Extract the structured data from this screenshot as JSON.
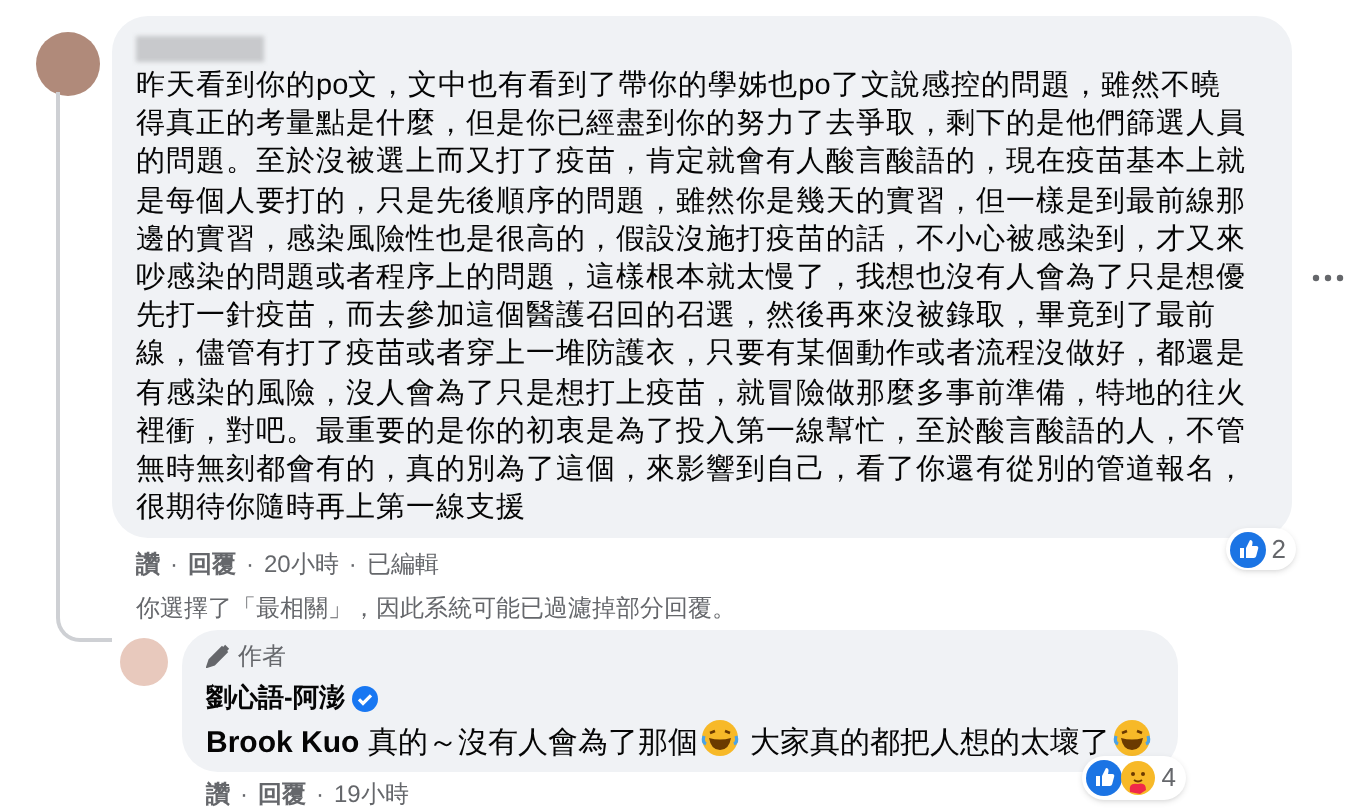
{
  "comment": {
    "text": "昨天看到你的po文，文中也有看到了帶你的學姊也po了文說感控的問題，雖然不曉得真正的考量點是什麼，但是你已經盡到你的努力了去爭取，剩下的是他們篩選人員的問題。至於沒被選上而又打了疫苗，肯定就會有人酸言酸語的，現在疫苗基本上就是每個人要打的，只是先後順序的問題，雖然你是幾天的實習，但一樣是到最前線那邊的實習，感染風險性也是很高的，假設沒施打疫苗的話，不小心被感染到，才又來吵感染的問題或者程序上的問題，這樣根本就太慢了，我想也沒有人會為了只是想優先打一針疫苗，而去參加這個醫護召回的召選，然後再來沒被錄取，畢竟到了最前線，儘管有打了疫苗或者穿上一堆防護衣，只要有某個動作或者流程沒做好，都還是有感染的風險，沒人會為了只是想打上疫苗，就冒險做那麼多事前準備，特地的往火裡衝，對吧。最重要的是你的初衷是為了投入第一線幫忙，至於酸言酸語的人，不管無時無刻都會有的，真的別為了這個，來影響到自己，看了你還有從別的管道報名，很期待你隨時再上第一線支援",
    "actions": [
      "讚",
      "回覆",
      "20小時",
      "已編輯"
    ],
    "reaction_count": "2"
  },
  "separator": "·",
  "filter_notice": "你選擇了「最相關」，因此系統可能已過濾掉部分回覆。",
  "reply": {
    "badge": "作者",
    "author": "劉心語-阿澎",
    "verified": true,
    "parts": [
      {
        "kind": "text",
        "text": "**Brook Kuo** 真的～沒有人會為了那個"
      },
      {
        "kind": "emoji"
      },
      {
        "kind": "text",
        "text": " 大家真的都把人想的太壞了"
      },
      {
        "kind": "emoji"
      }
    ],
    "actions": [
      "讚",
      "回覆",
      "19小時"
    ],
    "reaction_count": "4"
  }
}
